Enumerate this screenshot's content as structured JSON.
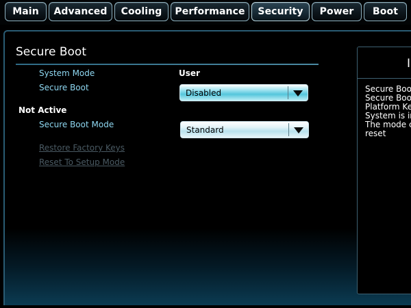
{
  "tabs": [
    {
      "label": "Main"
    },
    {
      "label": "Advanced"
    },
    {
      "label": "Cooling"
    },
    {
      "label": "Performance"
    },
    {
      "label": "Security"
    },
    {
      "label": "Power"
    },
    {
      "label": "Boot"
    }
  ],
  "active_tab": "Security",
  "page": {
    "title": "Secure Boot",
    "system_mode": {
      "label": "System Mode",
      "value": "User"
    },
    "secure_boot": {
      "label": "Secure Boot",
      "value": "Disabled"
    },
    "status_label": "Not Active",
    "secure_boot_mode": {
      "label": "Secure Boot Mode",
      "value": "Standard"
    },
    "restore_factory_keys": "Restore Factory Keys",
    "reset_to_setup_mode": "Reset To Setup Mode"
  },
  "help": {
    "title": "In",
    "lines": [
      "Secure Boot",
      "Secure Boot",
      "Platform Key",
      "System is in",
      "The mode ch",
      "reset"
    ]
  },
  "colors": {
    "accent": "#8fd8f2",
    "tab_border": "#8fb2c0",
    "dropdown_highlight": "#55c6dc",
    "disabled_link": "#4a5a63"
  },
  "icons": {
    "dropdown_arrow": "triangle-down"
  }
}
